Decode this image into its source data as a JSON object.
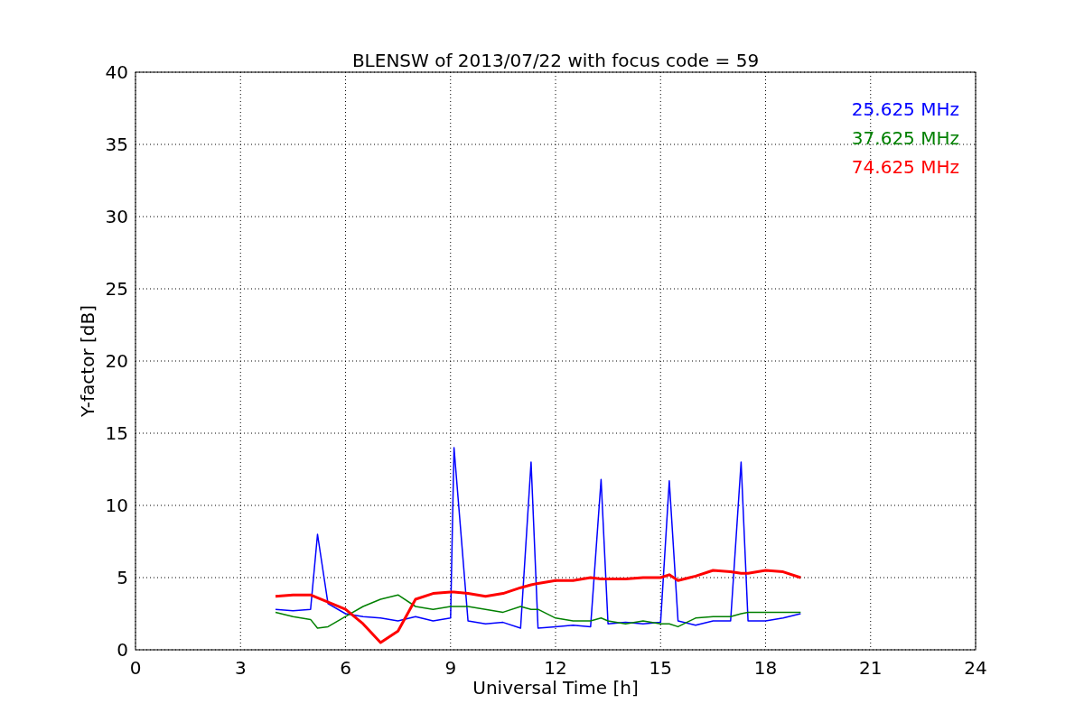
{
  "chart_data": {
    "type": "line",
    "title": "BLENSW of 2013/07/22 with focus code = 59",
    "xlabel": "Universal Time [h]",
    "ylabel": "Y-factor [dB]",
    "x": [
      4,
      4.5,
      5,
      5.2,
      5.5,
      6,
      6.5,
      7,
      7.5,
      8,
      8.5,
      9,
      9.1,
      9.5,
      10,
      10.5,
      11,
      11.3,
      11.5,
      12,
      12.5,
      13,
      13.3,
      13.5,
      14,
      14.5,
      15,
      15.25,
      15.5,
      16,
      16.5,
      17,
      17.3,
      17.5,
      18,
      18.5,
      19
    ],
    "series": [
      {
        "name": "25.625 MHz",
        "color": "#0000ff",
        "values": [
          2.8,
          2.7,
          2.8,
          8,
          3.2,
          2.5,
          2.3,
          2.2,
          2.0,
          2.3,
          2.0,
          2.2,
          14,
          2.0,
          1.8,
          1.9,
          1.5,
          13,
          1.5,
          1.6,
          1.7,
          1.6,
          11.8,
          1.8,
          1.9,
          1.8,
          1.9,
          11.7,
          2.0,
          1.7,
          2.0,
          2.0,
          13,
          2.0,
          2.0,
          2.2,
          2.5
        ]
      },
      {
        "name": "37.625 MHz",
        "color": "#008000",
        "values": [
          2.6,
          2.3,
          2.1,
          1.5,
          1.6,
          2.3,
          3.0,
          3.5,
          3.8,
          3.0,
          2.8,
          3.0,
          3.0,
          3.0,
          2.8,
          2.6,
          3.0,
          2.8,
          2.8,
          2.2,
          2.0,
          2.0,
          2.2,
          2.0,
          1.8,
          2.0,
          1.8,
          1.8,
          1.6,
          2.2,
          2.3,
          2.3,
          2.5,
          2.6,
          2.6,
          2.6,
          2.6
        ]
      },
      {
        "name": "74.625 MHz",
        "color": "#ff0000",
        "values": [
          3.7,
          3.8,
          3.8,
          3.6,
          3.3,
          2.8,
          1.8,
          0.5,
          1.3,
          3.5,
          3.9,
          4.0,
          4.0,
          3.9,
          3.7,
          3.9,
          4.3,
          4.5,
          4.6,
          4.8,
          4.8,
          5.0,
          4.9,
          4.9,
          4.9,
          5.0,
          5.0,
          5.2,
          4.8,
          5.1,
          5.5,
          5.4,
          5.3,
          5.3,
          5.5,
          5.4,
          5.0
        ]
      }
    ],
    "grid": true,
    "xlim": [
      0,
      24
    ],
    "ylim": [
      0,
      40
    ],
    "xticks": [
      0,
      3,
      6,
      9,
      12,
      15,
      18,
      21,
      24
    ],
    "yticks": [
      0,
      5,
      10,
      15,
      20,
      25,
      30,
      35,
      40
    ]
  }
}
